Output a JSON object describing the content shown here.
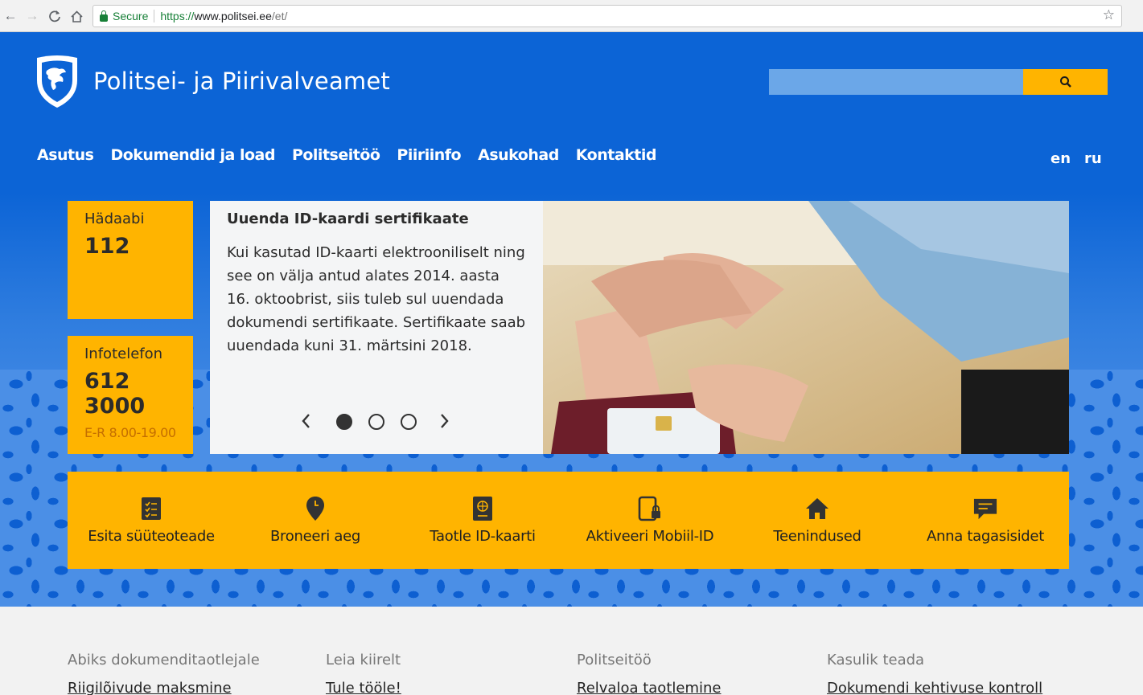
{
  "browser": {
    "secure_label": "Secure",
    "url_scheme": "https://",
    "url_host": "www.politsei.ee",
    "url_path": "/et/"
  },
  "header": {
    "site_title": "Politsei- ja Piirivalveamet",
    "search_placeholder": "",
    "search_icon": "search-icon"
  },
  "nav": {
    "items": [
      "Asutus",
      "Dokumendid ja load",
      "Politseitöö",
      "Piiriinfo",
      "Asukohad",
      "Kontaktid"
    ],
    "languages": [
      "en",
      "ru"
    ]
  },
  "info_boxes": {
    "emergency": {
      "label": "Hädaabi",
      "number": "112"
    },
    "infophone": {
      "label": "Infotelefon",
      "number": "612 3000",
      "hours": "E-R 8.00-19.00"
    }
  },
  "carousel": {
    "title": "Uuenda ID-kaardi sertifikaate",
    "body": "Kui kasutad ID-kaarti elektrooniliselt ning see on välja antud alates 2014. aasta 16. oktoobrist, siis tuleb sul uuendada dokumendi sertifikaate. Sertifikaate saab uuendada kuni 31. märtsini 2018.",
    "slide_count": 3,
    "active_slide": 1
  },
  "quick_links": [
    {
      "label": "Esita süüteoteade",
      "icon": "report-list-icon"
    },
    {
      "label": "Broneeri aeg",
      "icon": "location-pin-clock-icon"
    },
    {
      "label": "Taotle ID-kaarti",
      "icon": "passport-icon"
    },
    {
      "label": "Aktiveeri Mobiil-ID",
      "icon": "mobile-lock-icon"
    },
    {
      "label": "Teenindused",
      "icon": "home-icon"
    },
    {
      "label": "Anna tagasisidet",
      "icon": "feedback-chat-icon"
    }
  ],
  "footer": {
    "columns": [
      {
        "heading": "Abiks dokumenditaotlejale",
        "first_link": "Riigilõivude maksmine"
      },
      {
        "heading": "Leia kiirelt",
        "first_link": "Tule tööle!"
      },
      {
        "heading": "Politseitöö",
        "first_link": "Relvaloa taotlemine"
      },
      {
        "heading": "Kasulik teada",
        "first_link": "Dokumendi kehtivuse kontroll"
      }
    ]
  },
  "colors": {
    "brand_blue": "#0c64d6",
    "accent_yellow": "#ffb400",
    "secure_green": "#188038"
  }
}
